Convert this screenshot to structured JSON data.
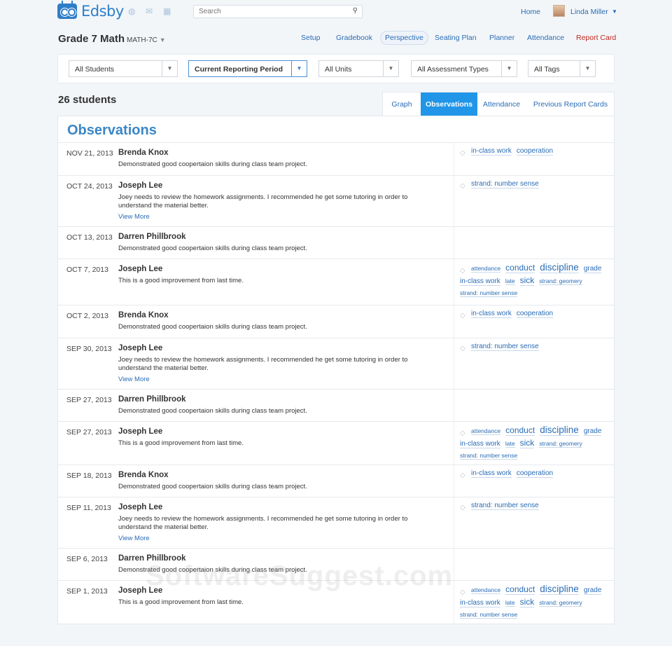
{
  "app": {
    "name": "Edsby"
  },
  "topbar": {
    "search_placeholder": "Search",
    "home_label": "Home",
    "user_name": "Linda Miller"
  },
  "course": {
    "title": "Grade 7 Math",
    "code": "MATH-7C"
  },
  "nav": [
    "Setup",
    "Gradebook",
    "Perspective",
    "Seating Plan",
    "Planner",
    "Attendance",
    "Report Card"
  ],
  "nav_active": "Perspective",
  "filters": [
    "All Students",
    "Current Reporting Period",
    "All Units",
    "All Assessment Types",
    "All Tags"
  ],
  "students_count": "26 students",
  "tabs": [
    "Graph",
    "Observations",
    "Attendance",
    "Previous Report Cards"
  ],
  "tabs_active": "Observations",
  "observations_title": "Observations",
  "tag_sets": {
    "a": [
      [
        "in-class work",
        "md"
      ],
      [
        "cooperation",
        "md"
      ]
    ],
    "b": [
      [
        "strand: number sense",
        "md"
      ]
    ],
    "c": [
      [
        "attendance",
        "sm"
      ],
      [
        "conduct",
        "lg"
      ],
      [
        "discipline",
        "xl"
      ],
      [
        "grade",
        "md"
      ],
      [
        "in-class work",
        "md"
      ],
      [
        "late",
        "sm"
      ],
      [
        "sick",
        "lg"
      ],
      [
        "strand: geomery",
        "sm"
      ],
      [
        "strand: number sense",
        "sm"
      ]
    ]
  },
  "observations": [
    {
      "date": "NOV 21, 2013",
      "name": "Brenda Knox",
      "note": "Demonstrated good coopertaion skills during class team project.",
      "more": "",
      "tags": "a"
    },
    {
      "date": "OCT 24, 2013",
      "name": "Joseph Lee",
      "note": "Joey needs to review the homework assignments. I recommended he get some tutoring in order to understand the material better.",
      "more": "View More",
      "tags": "b"
    },
    {
      "date": "OCT 13, 2013",
      "name": "Darren Phillbrook",
      "note": "Demonstrated good coopertaion skills during class team project.",
      "more": "",
      "tags": ""
    },
    {
      "date": "OCT 7, 2013",
      "name": "Joseph Lee",
      "note": "This is a good improvement from last time.",
      "more": "",
      "tags": "c"
    },
    {
      "date": "OCT 2, 2013",
      "name": "Brenda Knox",
      "note": "Demonstrated good coopertaion skills during class team project.",
      "more": "",
      "tags": "a"
    },
    {
      "date": "SEP 30, 2013",
      "name": "Joseph Lee",
      "note": "Joey needs to review the homework assignments. I recommended he get some tutoring in order to understand the material better.",
      "more": "View More",
      "tags": "b"
    },
    {
      "date": "SEP 27, 2013",
      "name": "Darren Phillbrook",
      "note": "Demonstrated good coopertaion skills during class team project.",
      "more": "",
      "tags": ""
    },
    {
      "date": "SEP 27, 2013",
      "name": "Joseph Lee",
      "note": "This is a good improvement from last time.",
      "more": "",
      "tags": "c"
    },
    {
      "date": "SEP 18, 2013",
      "name": "Brenda Knox",
      "note": "Demonstrated good coopertaion skills during class team project.",
      "more": "",
      "tags": "a"
    },
    {
      "date": "SEP 11, 2013",
      "name": "Joseph Lee",
      "note": "Joey needs to review the homework assignments. I recommended he get some tutoring in order to understand the material better.",
      "more": "View More",
      "tags": "b"
    },
    {
      "date": "SEP 6, 2013",
      "name": "Darren Phillbrook",
      "note": "Demonstrated good coopertaion skills during class team project.",
      "more": "",
      "tags": ""
    },
    {
      "date": "SEP 1, 2013",
      "name": "Joseph Lee",
      "note": "This is a good improvement from last time.",
      "more": "",
      "tags": "c"
    }
  ],
  "watermark": "SoftwareSuggest.com"
}
